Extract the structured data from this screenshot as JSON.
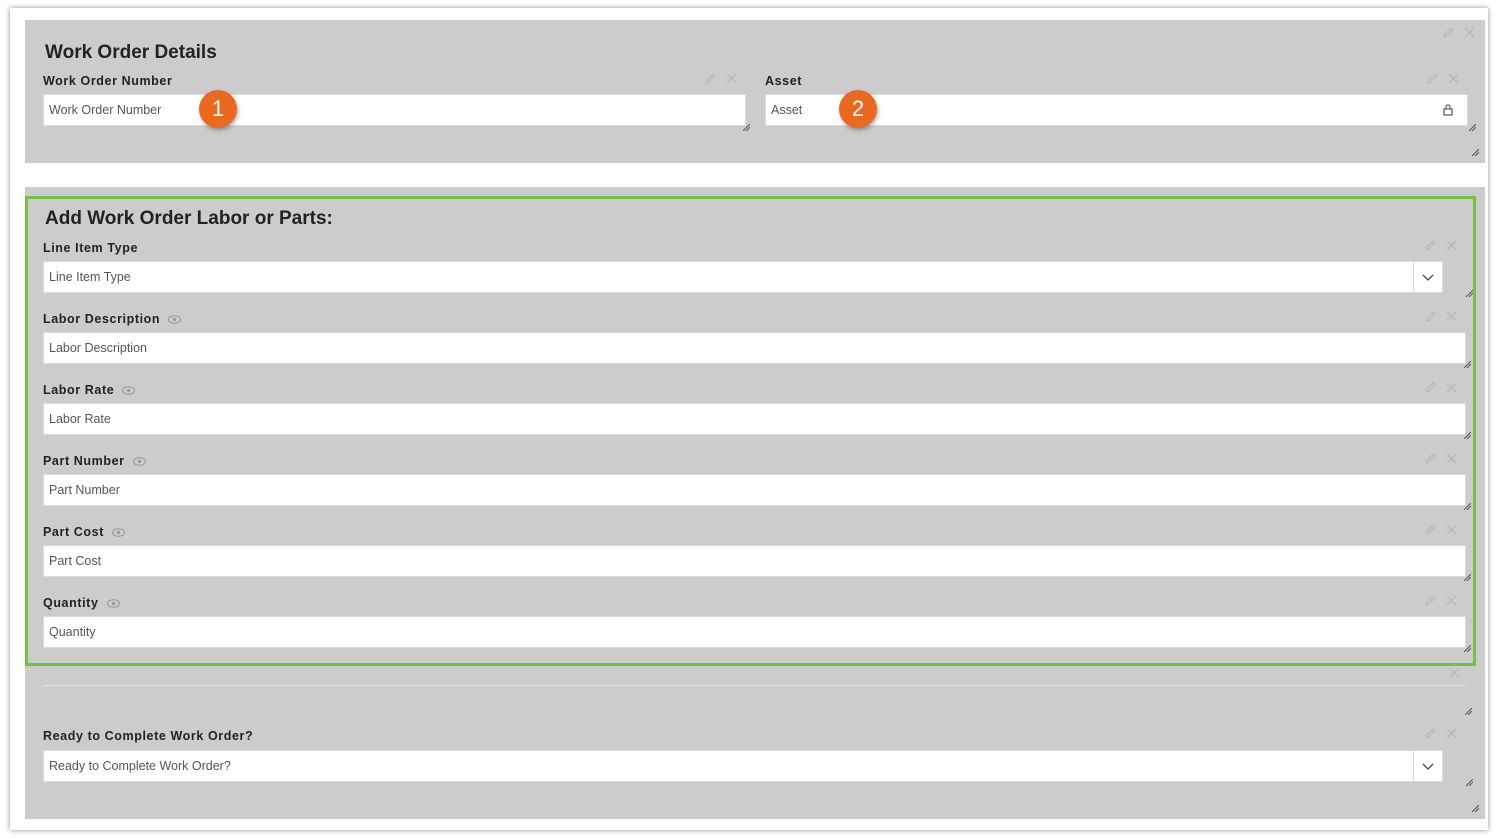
{
  "details": {
    "title": "Work Order Details",
    "work_order_number": {
      "label": "Work Order Number",
      "placeholder": "Work Order Number"
    },
    "asset": {
      "label": "Asset",
      "placeholder": "Asset"
    }
  },
  "badges": {
    "one": "1",
    "two": "2"
  },
  "labor": {
    "title": "Add Work Order Labor or Parts:",
    "line_item_type": {
      "label": "Line Item Type",
      "placeholder": "Line Item Type"
    },
    "labor_description": {
      "label": "Labor Description",
      "placeholder": "Labor Description"
    },
    "labor_rate": {
      "label": "Labor Rate",
      "placeholder": "Labor Rate"
    },
    "part_number": {
      "label": "Part Number",
      "placeholder": "Part Number"
    },
    "part_cost": {
      "label": "Part Cost",
      "placeholder": "Part Cost"
    },
    "quantity": {
      "label": "Quantity",
      "placeholder": "Quantity"
    }
  },
  "complete": {
    "ready": {
      "label": "Ready to Complete Work Order?",
      "placeholder": "Ready to Complete Work Order?"
    }
  },
  "colors": {
    "panel": "#cccccc",
    "highlight": "#78c043",
    "badge": "#e8691f"
  },
  "icons": {
    "edit": "pencil-icon",
    "remove": "close-icon",
    "lock": "lock-icon",
    "visible": "eye-icon",
    "dropdown": "chevron-down-icon"
  }
}
